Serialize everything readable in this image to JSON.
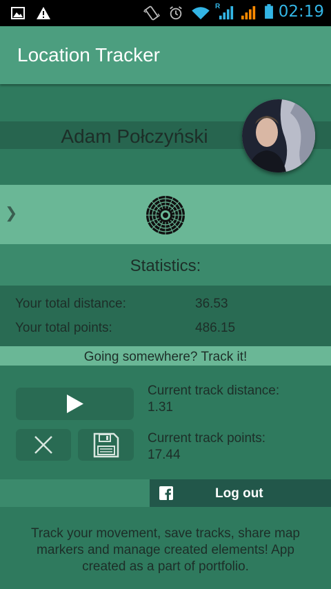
{
  "status_bar": {
    "time": "02:19",
    "roaming_label": "R"
  },
  "app_bar": {
    "title": "Location Tracker"
  },
  "profile": {
    "name": "Adam Połczyński"
  },
  "statistics": {
    "title": "Statistics:",
    "total_distance_label": "Your total distance:",
    "total_distance_value": "36.53",
    "total_points_label": "Your total points:",
    "total_points_value": "486.15"
  },
  "tracking": {
    "banner": "Going somewhere? Track it!",
    "current_distance_label": "Current track distance:",
    "current_distance_value": "1.31",
    "current_points_label": "Current track points:",
    "current_points_value": "17.44"
  },
  "logout": {
    "label": "Log out"
  },
  "footer": {
    "text": "Track your movement, save tracks, share map markers and manage created elements! App created as a part of portfolio."
  },
  "icons": {
    "drawer": "chevron-right-icon",
    "logo": "mandala-logo-icon",
    "play": "play-icon",
    "cancel": "close-icon",
    "save": "floppy-disk-icon",
    "facebook": "facebook-icon"
  },
  "colors": {
    "status_time": "#33b5e5",
    "app_bar": "#4c9e7f",
    "background": "#2f7a5e",
    "accent_band": "#6ab796"
  }
}
